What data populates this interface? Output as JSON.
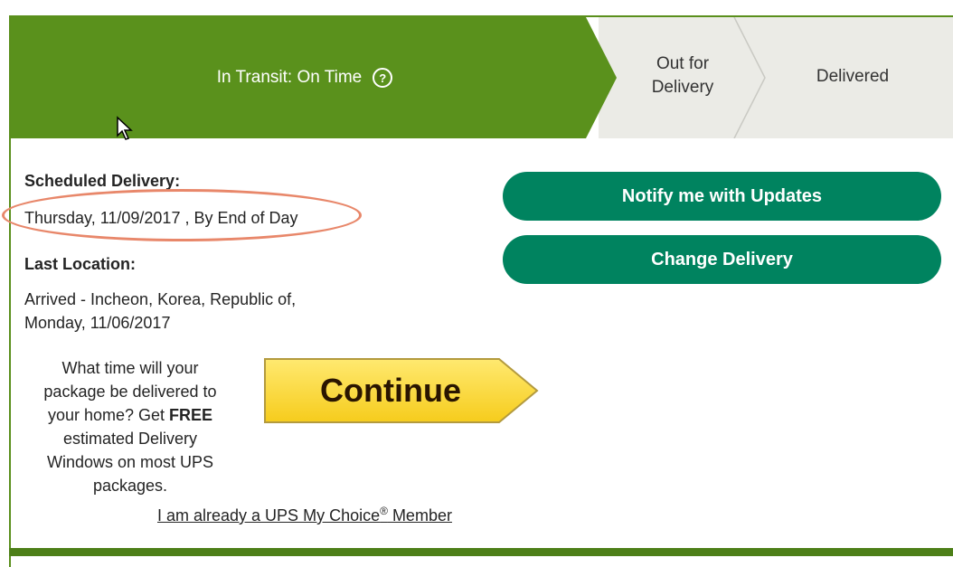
{
  "tracker": {
    "current_step": "In Transit: On Time",
    "help_icon": "question-circle-icon",
    "step2_line1": "Out for",
    "step2_line2": "Delivery",
    "step3": "Delivered",
    "colors": {
      "active": "#5a911c",
      "inactive": "#ebebe6"
    }
  },
  "scheduled": {
    "label": "Scheduled Delivery:",
    "value": "Thursday, 11/09/2017 , By End of Day"
  },
  "last_location": {
    "label": "Last Location:",
    "line1": "Arrived - Incheon, Korea, Republic of,",
    "line2": "Monday, 11/06/2017"
  },
  "buttons": {
    "notify": "Notify me with Updates",
    "change": "Change Delivery",
    "color": "#00835f"
  },
  "promo": {
    "line1": "What time will your",
    "line2": "package be delivered to",
    "line3_pre": "your home? Get ",
    "line3_bold": "FREE",
    "line4": "estimated Delivery",
    "line5": "Windows on most UPS",
    "line6": "packages."
  },
  "continue_button": {
    "label": "Continue",
    "color": "#fbd83a"
  },
  "member_link": {
    "pre": "I am already a UPS My Choice",
    "sup": "®",
    "post": " Member"
  }
}
